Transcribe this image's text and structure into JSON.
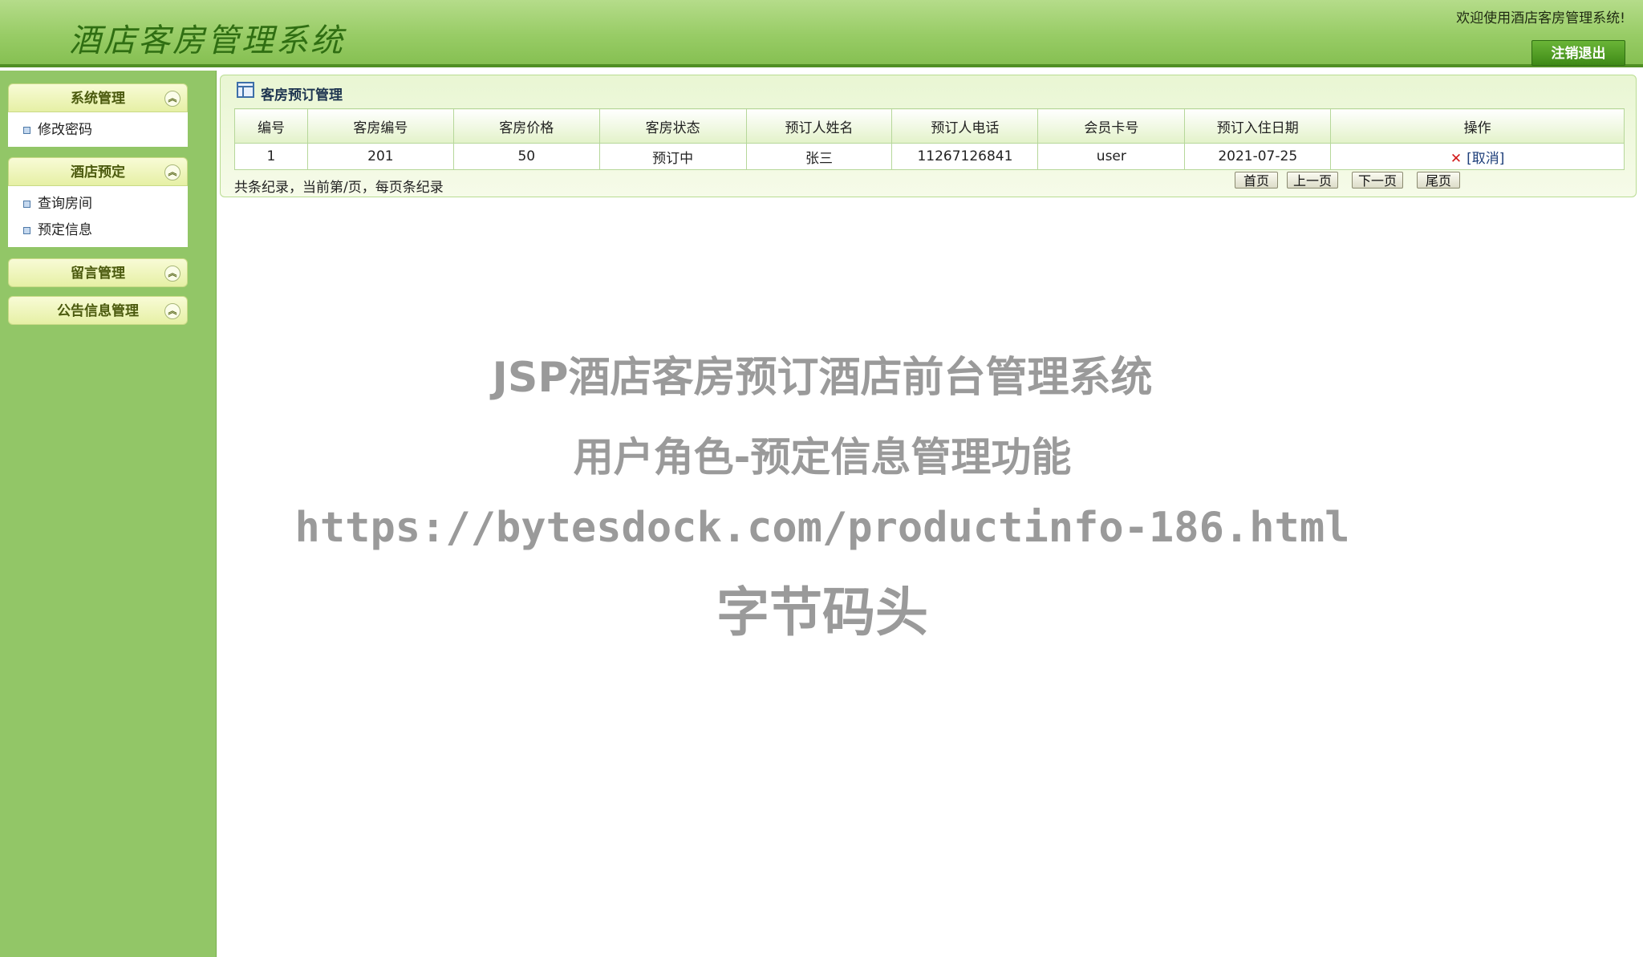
{
  "header": {
    "app_title": "酒店客房管理系统",
    "welcome": "欢迎使用酒店客房管理系统!",
    "logout_label": "注销退出"
  },
  "sidebar": {
    "groups": [
      {
        "title": "系统管理",
        "items": [
          "修改密码"
        ]
      },
      {
        "title": "酒店预定",
        "items": [
          "查询房间",
          "预定信息"
        ]
      },
      {
        "title": "留言管理",
        "items": []
      },
      {
        "title": "公告信息管理",
        "items": []
      }
    ]
  },
  "panel": {
    "title": "客房预订管理",
    "columns": [
      "编号",
      "客房编号",
      "客房价格",
      "客房状态",
      "预订人姓名",
      "预订人电话",
      "会员卡号",
      "预订入住日期",
      "操作"
    ],
    "rows": [
      {
        "id": "1",
        "room_no": "201",
        "price": "50",
        "status": "预订中",
        "name": "张三",
        "phone": "11267126841",
        "card": "user",
        "date": "2021-07-25",
        "action": "[取消]"
      }
    ],
    "pager_info": "共条纪录，当前第/页，每页条纪录",
    "pager": {
      "first": "首页",
      "prev": "上一页",
      "next": "下一页",
      "last": "尾页"
    }
  },
  "watermark": {
    "line1": "JSP酒店客房预订酒店前台管理系统",
    "line2": "用户角色-预定信息管理功能",
    "line3": "https://bytesdock.com/productinfo-186.html",
    "line4": "字节码头"
  },
  "icons": {
    "collapse": "double-chevron-up-icon",
    "panel": "table-icon",
    "delete": "close-x-icon",
    "bullet": "square-bullet-icon"
  },
  "colors": {
    "header_green": "#98cc66",
    "sidebar_green": "#92c667",
    "accent_dark_green": "#3f8a17",
    "delete_red": "#d21a1a"
  }
}
